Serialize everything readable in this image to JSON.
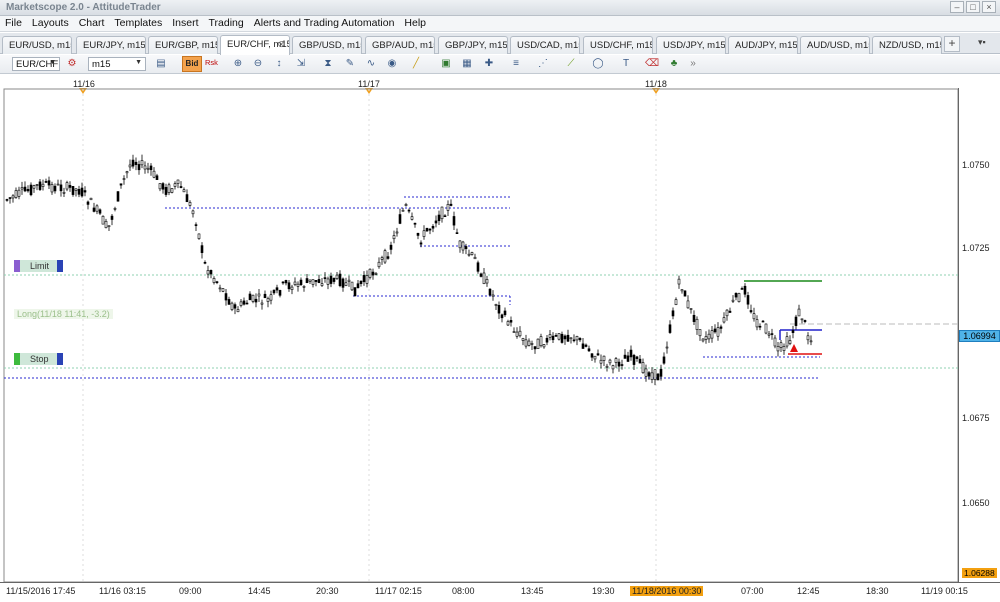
{
  "window": {
    "title": "Marketscope 2.0 - AttitudeTrader"
  },
  "menu": [
    "File",
    "Layouts",
    "Chart",
    "Templates",
    "Insert",
    "Trading",
    "Alerts and Trading Automation",
    "Help"
  ],
  "tabs": [
    {
      "label": "EUR/USD, m15",
      "active": false
    },
    {
      "label": "EUR/JPY, m15",
      "active": false
    },
    {
      "label": "EUR/GBP, m15",
      "active": false
    },
    {
      "label": "EUR/CHF, m15",
      "active": true
    },
    {
      "label": "GBP/USD, m15",
      "active": false
    },
    {
      "label": "GBP/AUD, m15",
      "active": false
    },
    {
      "label": "GBP/JPY, m15",
      "active": false
    },
    {
      "label": "USD/CAD, m15",
      "active": false
    },
    {
      "label": "USD/CHF, m15",
      "active": false
    },
    {
      "label": "USD/JPY, m15",
      "active": false
    },
    {
      "label": "AUD/JPY, m15",
      "active": false
    },
    {
      "label": "AUD/USD, m15",
      "active": false
    },
    {
      "label": "NZD/USD, m15",
      "active": false
    }
  ],
  "toolbar": {
    "instrument": "EUR/CHF",
    "timeframe": "m15",
    "bid_label": "Bid",
    "risk_label": "Rsk"
  },
  "chart": {
    "date_markers": [
      "11/16",
      "11/17",
      "11/18"
    ],
    "price_labels": [
      "1.0750",
      "1.0725",
      "1.0700",
      "1.0675",
      "1.0650"
    ],
    "current_price": "1.06994",
    "low_price": "1.06288",
    "time_labels": [
      "11/15/2016 17:45",
      "11/16 03:15",
      "09:00",
      "14:45",
      "20:30",
      "11/17 02:15",
      "08:00",
      "13:45",
      "19:30",
      "11/18/2016 00:30",
      "07:00",
      "12:45",
      "18:30",
      "11/19 00:15"
    ],
    "limit_label": "Limit",
    "stop_label": "Stop",
    "position_label": "Long(11/18 11:41, -3.2)",
    "colors": {
      "candle": "#000000",
      "level": "#2a2ad0",
      "tp": "#1a8a1a",
      "sl": "#e01010",
      "limit_line": "#8fd0b0"
    }
  }
}
